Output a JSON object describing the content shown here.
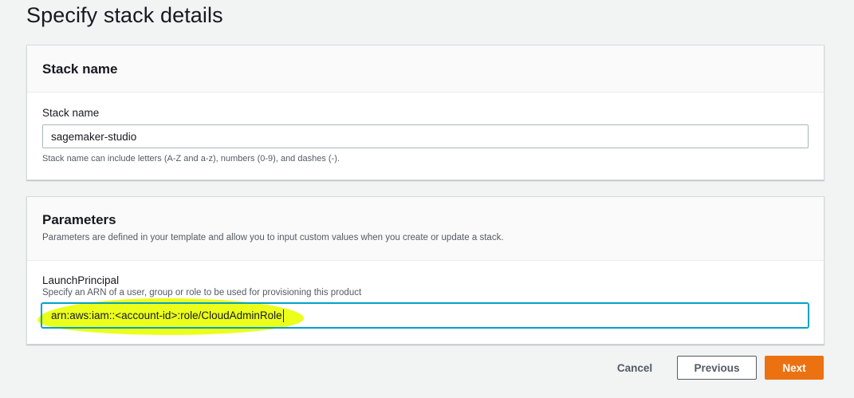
{
  "page": {
    "title": "Specify stack details"
  },
  "stack_name_panel": {
    "title": "Stack name",
    "field_label": "Stack name",
    "value": "sagemaker-studio",
    "constraint": "Stack name can include letters (A-Z and a-z), numbers (0-9), and dashes (-)."
  },
  "parameters_panel": {
    "title": "Parameters",
    "description": "Parameters are defined in your template and allow you to input custom values when you create or update a stack.",
    "launch_principal": {
      "label": "LaunchPrincipal",
      "description": "Specify an ARN of a user, group or role to be used for provisioning this product",
      "value": "arn:aws:iam::<account-id>:role/CloudAdminRole"
    }
  },
  "footer": {
    "cancel_label": "Cancel",
    "previous_label": "Previous",
    "next_label": "Next"
  },
  "colors": {
    "primary_button": "#ec7211",
    "focus_ring": "#00a1c9",
    "highlight": "#ecff1b",
    "page_background": "#f2f3f3"
  }
}
